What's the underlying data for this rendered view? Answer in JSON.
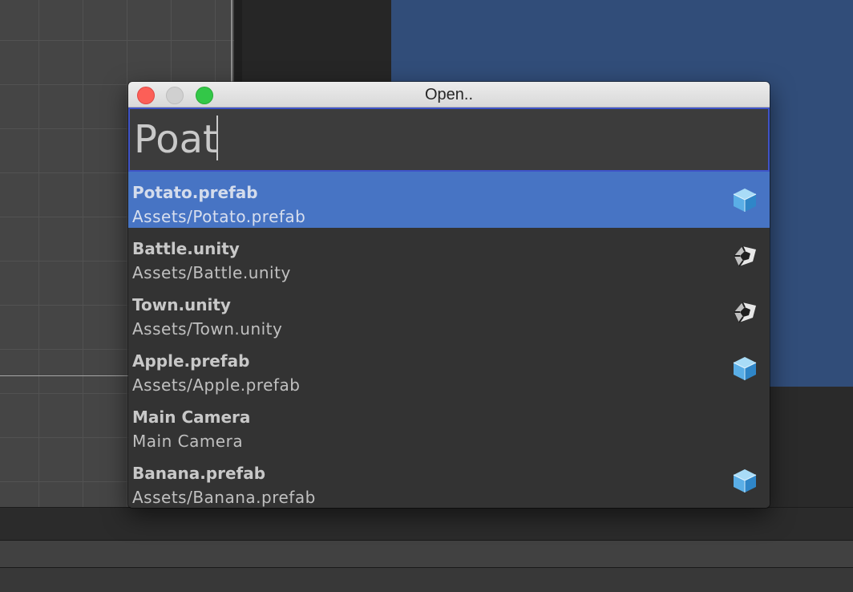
{
  "window": {
    "title": "Open.."
  },
  "search": {
    "value": "Poat"
  },
  "results": [
    {
      "name": "Potato.prefab",
      "path": "Assets/Potato.prefab",
      "icon": "prefab-cube-icon",
      "selected": true
    },
    {
      "name": "Battle.unity",
      "path": "Assets/Battle.unity",
      "icon": "unity-scene-icon",
      "selected": false
    },
    {
      "name": "Town.unity",
      "path": "Assets/Town.unity",
      "icon": "unity-scene-icon",
      "selected": false
    },
    {
      "name": "Apple.prefab",
      "path": "Assets/Apple.prefab",
      "icon": "prefab-cube-icon",
      "selected": false
    },
    {
      "name": "Main Camera",
      "path": "Main Camera",
      "icon": "",
      "selected": false
    },
    {
      "name": "Banana.prefab",
      "path": "Assets/Banana.prefab",
      "icon": "prefab-cube-icon",
      "selected": false
    }
  ],
  "colors": {
    "selection": "#4774c4",
    "search_focus_border": "#3f54c9",
    "game_view": "#314d79",
    "close": "#fc5f57",
    "minimize": "#d0d0d0",
    "zoom": "#33c748"
  }
}
